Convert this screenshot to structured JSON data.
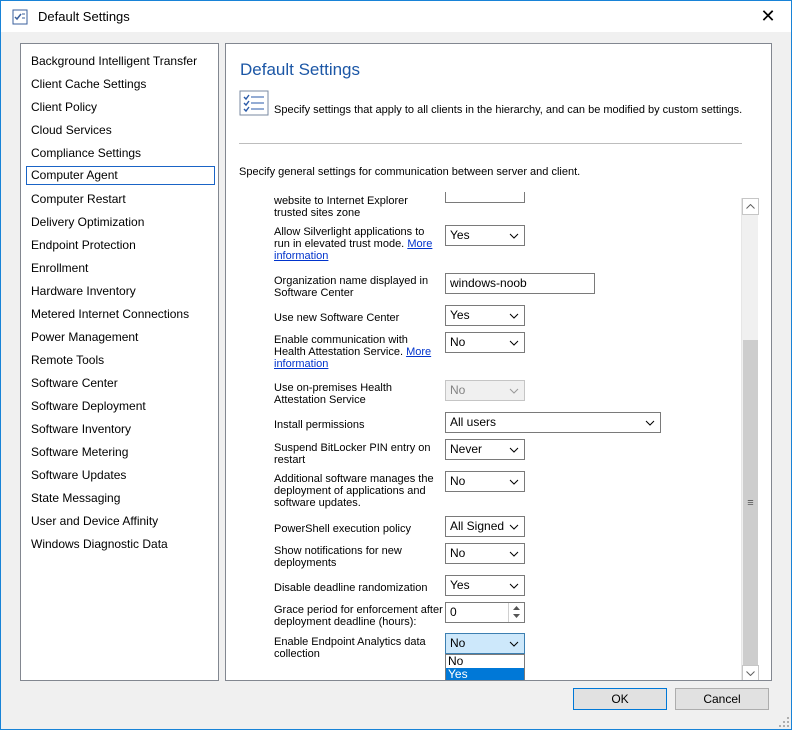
{
  "window": {
    "title": "Default Settings",
    "close_glyph": "✕"
  },
  "nav": {
    "items": [
      {
        "label": "Background Intelligent Transfer"
      },
      {
        "label": "Client Cache Settings"
      },
      {
        "label": "Client Policy"
      },
      {
        "label": "Cloud Services"
      },
      {
        "label": "Compliance Settings"
      },
      {
        "label": "Computer Agent",
        "selected": true
      },
      {
        "label": "Computer Restart"
      },
      {
        "label": "Delivery Optimization"
      },
      {
        "label": "Endpoint Protection"
      },
      {
        "label": "Enrollment"
      },
      {
        "label": "Hardware Inventory"
      },
      {
        "label": "Metered Internet Connections"
      },
      {
        "label": "Power Management"
      },
      {
        "label": "Remote Tools"
      },
      {
        "label": "Software Center"
      },
      {
        "label": "Software Deployment"
      },
      {
        "label": "Software Inventory"
      },
      {
        "label": "Software Metering"
      },
      {
        "label": "Software Updates"
      },
      {
        "label": "State Messaging"
      },
      {
        "label": "User and Device Affinity"
      },
      {
        "label": "Windows Diagnostic Data"
      }
    ]
  },
  "panel": {
    "title": "Default Settings",
    "description": "Specify settings that apply to all clients in the hierarchy, and can be modified by custom settings.",
    "general_description": "Specify general settings for communication between server and client."
  },
  "settings": {
    "trusted_sites": {
      "label": "website to Internet Explorer trusted sites zone"
    },
    "silverlight": {
      "label": "Allow Silverlight applications to run in elevated trust mode.",
      "link": "More information",
      "value": "Yes"
    },
    "org_name": {
      "label": "Organization name displayed in Software Center",
      "value": "windows-noob"
    },
    "new_software_center": {
      "label": "Use new Software Center",
      "value": "Yes"
    },
    "health_attestation": {
      "label": "Enable communication with Health Attestation Service.",
      "link": "More information",
      "value": "No"
    },
    "onprem_health": {
      "label": "Use on-premises Health Attestation Service",
      "value": "No"
    },
    "install_permissions": {
      "label": "Install permissions",
      "value": "All users"
    },
    "bitlocker": {
      "label": "Suspend BitLocker PIN entry on restart",
      "value": "Never"
    },
    "additional_software": {
      "label": "Additional software manages the deployment of applications and software updates.",
      "value": "No"
    },
    "powershell": {
      "label": "PowerShell execution policy",
      "value": "All Signed"
    },
    "notifications": {
      "label": "Show notifications for new deployments",
      "value": "No"
    },
    "deadline_random": {
      "label": "Disable deadline randomization",
      "value": "Yes"
    },
    "grace_period": {
      "label": "Grace period for enforcement after deployment deadline (hours):",
      "value": "0"
    },
    "endpoint_analytics": {
      "label": "Enable Endpoint Analytics data collection",
      "value": "No",
      "options": [
        "No",
        "Yes"
      ]
    }
  },
  "scrollbar": {
    "thumb_glyph": "≡"
  },
  "buttons": {
    "ok": "OK",
    "cancel": "Cancel"
  },
  "colors": {
    "accent": "#0078d7",
    "title_blue": "#1c57a6",
    "link": "#0033cc"
  }
}
